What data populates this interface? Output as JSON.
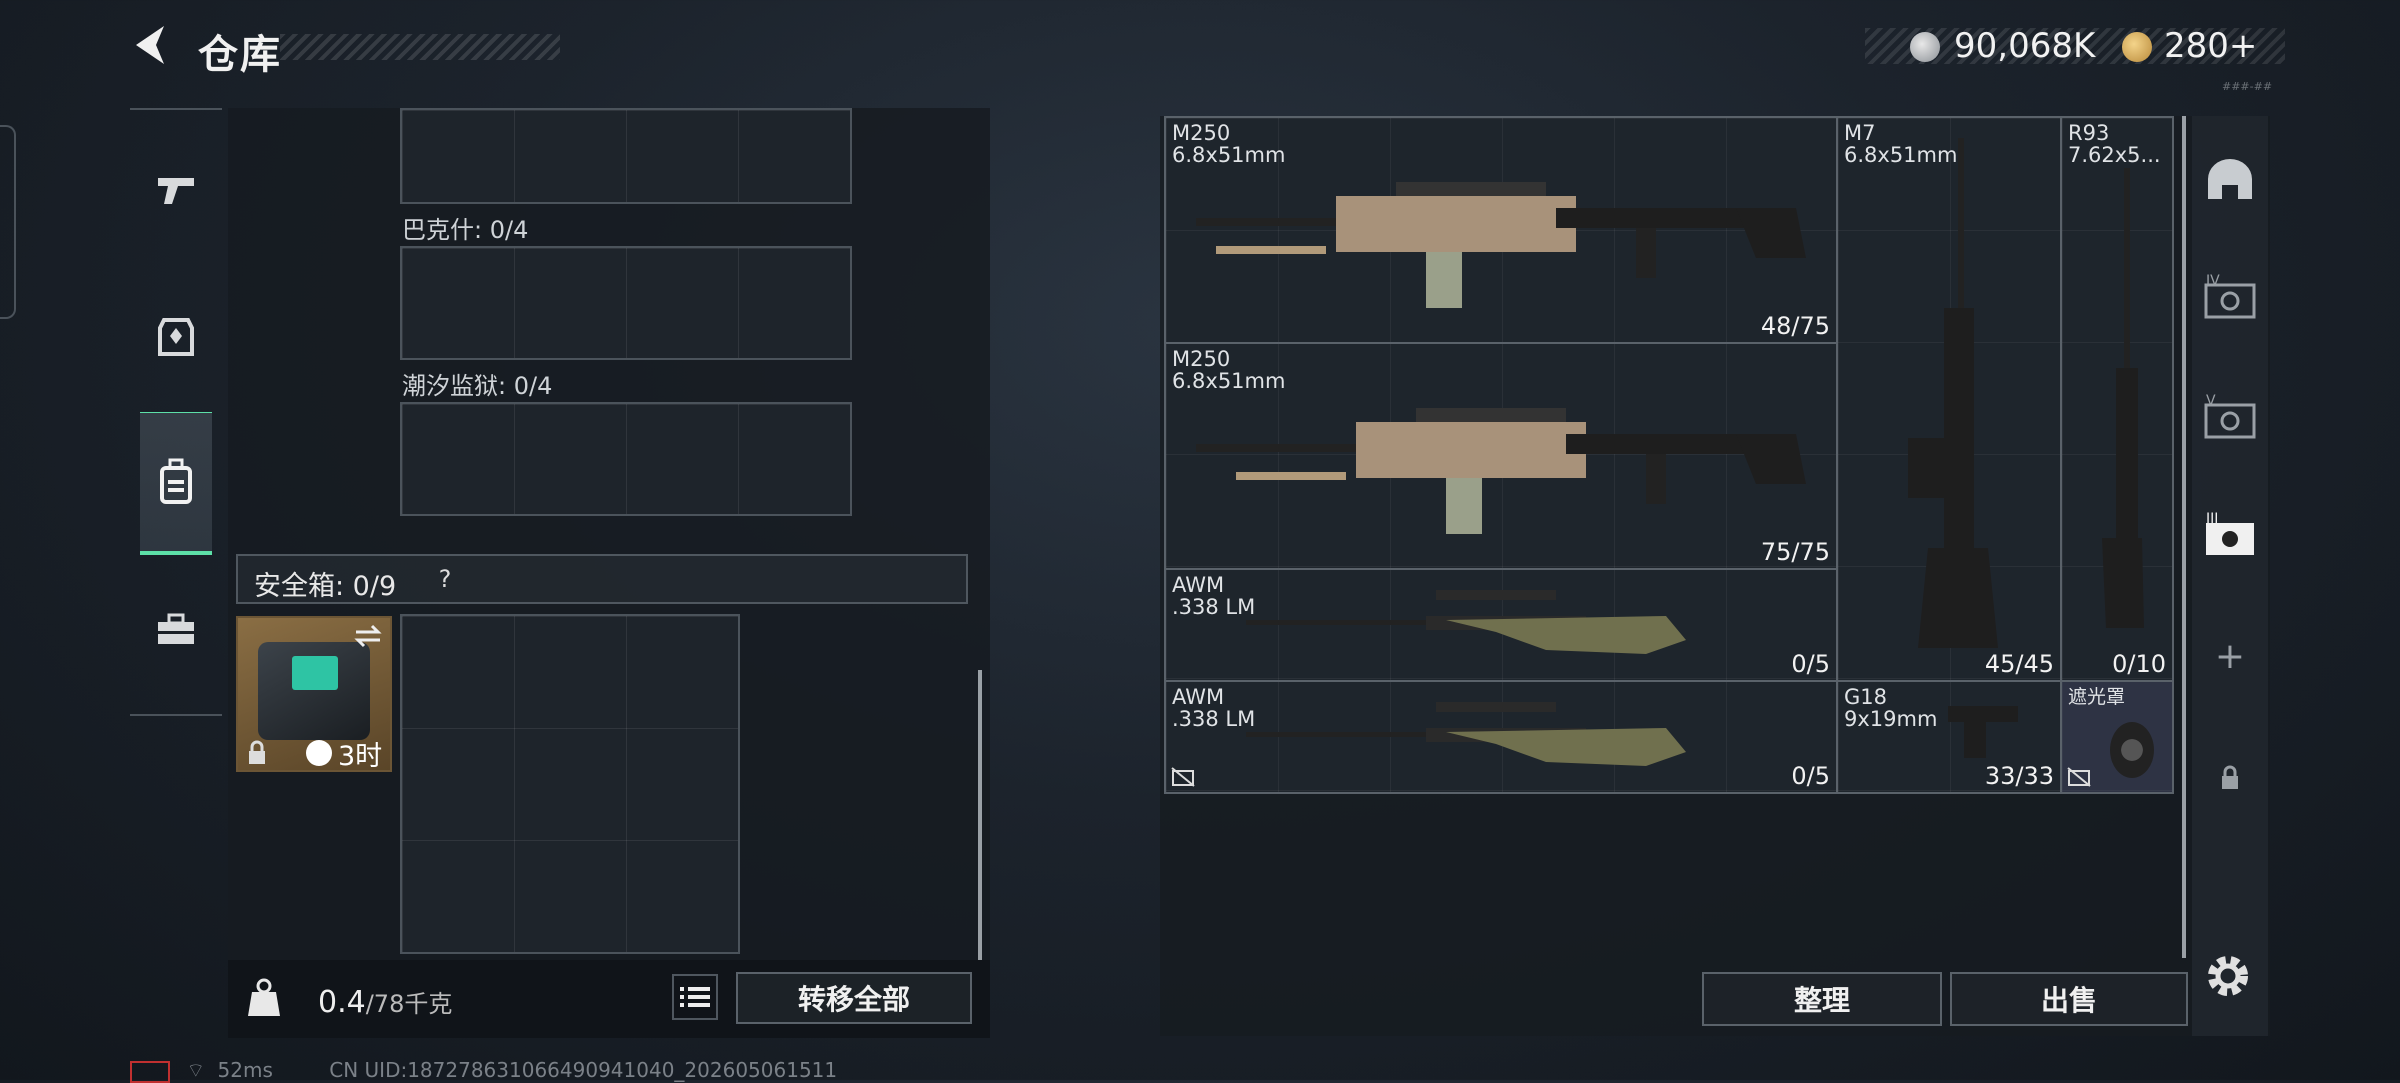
{
  "header": {
    "title": "仓库",
    "currency1": "90,068K",
    "currency2": "280+",
    "version": "###-##"
  },
  "left_nav": {
    "items": [
      {
        "name": "weapons-tab",
        "icon": "pistol-icon"
      },
      {
        "name": "armor-tab",
        "icon": "armor-icon"
      },
      {
        "name": "backpack-tab",
        "icon": "backpack-icon",
        "active": true
      },
      {
        "name": "toolbox-tab",
        "icon": "toolbox-icon"
      }
    ]
  },
  "containers": {
    "bakeshi_label": "巴克什: 0/4",
    "chaoxi_label": "潮汐监狱: 0/4",
    "safe_label": "安全箱: 0/9",
    "safe_help": "?",
    "case_time": "3时"
  },
  "weight": {
    "current": "0.4",
    "max": "/78千克"
  },
  "buttons": {
    "transfer_all": "转移全部",
    "sort": "整理",
    "sell": "出售"
  },
  "status": {
    "ping": "52ms",
    "uid": "CN UID:187278631066490941040_202605061511"
  },
  "stash_items": [
    {
      "name": "M250",
      "caliber": "6.8x51mm",
      "count": "48/75"
    },
    {
      "name": "M250",
      "caliber": "6.8x51mm",
      "count": "75/75"
    },
    {
      "name": "AWM",
      "caliber": ".338 LM",
      "count": "0/5"
    },
    {
      "name": "AWM",
      "caliber": ".338 LM",
      "count": "0/5"
    },
    {
      "name": "M7",
      "caliber": "6.8x51mm",
      "count": "45/45"
    },
    {
      "name": "R93",
      "caliber": "7.62x5...",
      "count": "0/10"
    },
    {
      "name": "G18",
      "caliber": "9x19mm",
      "count": "33/33"
    },
    {
      "name": "遮光罩",
      "caliber": "",
      "count": ""
    }
  ],
  "right_nav": {
    "items": [
      "helmet-icon",
      "tier-iv-icon",
      "tier-v-icon",
      "tier-iii-icon",
      "add-icon",
      "lock-icon"
    ]
  },
  "colors": {
    "accent": "#5de0a8",
    "case_teal": "#2ec4a4"
  }
}
